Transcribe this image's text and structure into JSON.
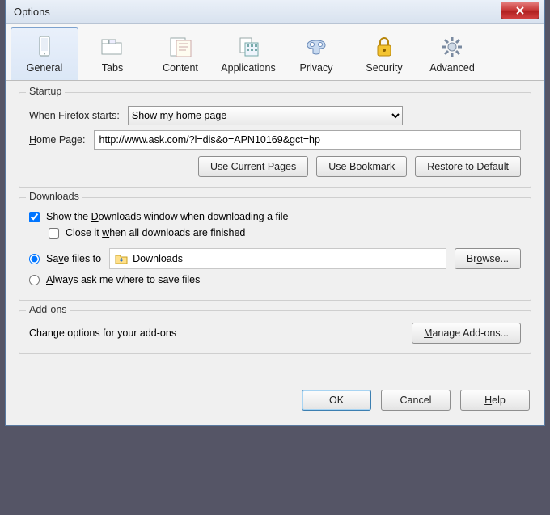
{
  "title": "Options",
  "tabs": [
    {
      "label": "General"
    },
    {
      "label": "Tabs"
    },
    {
      "label": "Content"
    },
    {
      "label": "Applications"
    },
    {
      "label": "Privacy"
    },
    {
      "label": "Security"
    },
    {
      "label": "Advanced"
    }
  ],
  "startup": {
    "legend": "Startup",
    "when_label_pre": "When Firefox ",
    "when_label_u": "s",
    "when_label_post": "tarts:",
    "when_value": "Show my home page",
    "home_u": "H",
    "home_post": "ome Page:",
    "home_value": "http://www.ask.com/?l=dis&o=APN10169&gct=hp",
    "use_current_pre": "Use ",
    "use_current_u": "C",
    "use_current_post": "urrent Pages",
    "use_bookmark_pre": "Use ",
    "use_bookmark_u": "B",
    "use_bookmark_post": "ookmark",
    "restore_u": "R",
    "restore_post": "estore to Default"
  },
  "downloads": {
    "legend": "Downloads",
    "show_pre": "Show the ",
    "show_u": "D",
    "show_post": "ownloads window when downloading a file",
    "close_pre": "Close it ",
    "close_u": "w",
    "close_post": "hen all downloads are finished",
    "save_pre": "Sa",
    "save_u": "v",
    "save_post": "e files to",
    "save_folder": "Downloads",
    "browse_pre": "Br",
    "browse_u": "o",
    "browse_post": "wse...",
    "ask_u": "A",
    "ask_post": "lways ask me where to save files"
  },
  "addons": {
    "legend": "Add-ons",
    "desc": "Change options for your add-ons",
    "manage_u": "M",
    "manage_post": "anage Add-ons..."
  },
  "footer": {
    "ok": "OK",
    "cancel": "Cancel",
    "help_u": "H",
    "help_post": "elp"
  }
}
